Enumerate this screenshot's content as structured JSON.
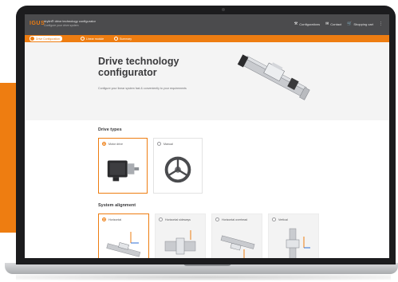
{
  "app": {
    "logo": "IGUS",
    "title": "drylin® drive technology configurator",
    "subtitle": "Configure your drive system"
  },
  "header_actions": [
    {
      "icon": "wrench-icon",
      "label": "Configurations"
    },
    {
      "icon": "mail-icon",
      "label": "Contact"
    },
    {
      "icon": "cart-icon",
      "label": "Shopping cart"
    }
  ],
  "steps": [
    {
      "label": "Drive Configuration",
      "active": true
    },
    {
      "label": "Linear module",
      "active": false
    },
    {
      "label": "Summary",
      "active": false
    }
  ],
  "hero": {
    "title": "Drive technology configurator",
    "description": "Configure your linear system fast & conveniently to your requirements"
  },
  "sections": {
    "drive_types": {
      "title": "Drive types",
      "options": [
        {
          "label": "Motor drive",
          "selected": true
        },
        {
          "label": "Manual",
          "selected": false
        }
      ]
    },
    "system_alignment": {
      "title": "System alignment",
      "options": [
        {
          "label": "Horizontal",
          "selected": true
        },
        {
          "label": "Horizontal sideways",
          "selected": false
        },
        {
          "label": "Horizontal overhead",
          "selected": false
        },
        {
          "label": "Vertical",
          "selected": false
        }
      ]
    }
  },
  "colors": {
    "accent": "#ee7d11",
    "header": "#4b4b4d",
    "bezel": "#1c1c1e"
  }
}
